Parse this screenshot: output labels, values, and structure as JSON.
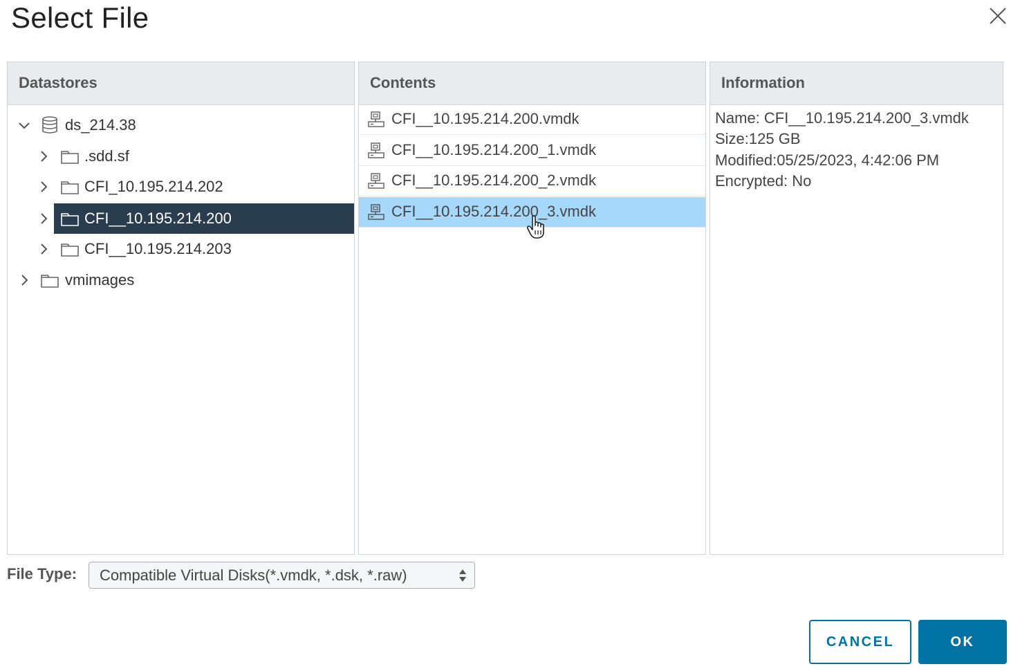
{
  "dialog": {
    "title": "Select File",
    "close_icon": "close-icon"
  },
  "datastores": {
    "header": "Datastores",
    "items": [
      {
        "label": "ds_214.38",
        "icon": "database-icon",
        "expanded": true,
        "level": 0
      },
      {
        "label": ".sdd.sf",
        "icon": "folder-icon",
        "expanded": false,
        "level": 1
      },
      {
        "label": "CFI_10.195.214.202",
        "icon": "folder-icon",
        "expanded": false,
        "level": 1
      },
      {
        "label": "CFI__10.195.214.200",
        "icon": "folder-icon",
        "expanded": false,
        "level": 1,
        "selected": true
      },
      {
        "label": "CFI__10.195.214.203",
        "icon": "folder-icon",
        "expanded": false,
        "level": 1
      },
      {
        "label": "vmimages",
        "icon": "folder-icon",
        "expanded": false,
        "level": 0
      }
    ]
  },
  "contents": {
    "header": "Contents",
    "items": [
      {
        "label": "CFI__10.195.214.200.vmdk",
        "icon": "virtual-disk-icon"
      },
      {
        "label": "CFI__10.195.214.200_1.vmdk",
        "icon": "virtual-disk-icon"
      },
      {
        "label": "CFI__10.195.214.200_2.vmdk",
        "icon": "virtual-disk-icon"
      },
      {
        "label": "CFI__10.195.214.200_3.vmdk",
        "icon": "virtual-disk-icon",
        "selected": true
      }
    ]
  },
  "information": {
    "header": "Information",
    "lines": [
      "Name: CFI__10.195.214.200_3.vmdk",
      "Size:125 GB",
      "Modified:05/25/2023, 4:42:06 PM",
      "Encrypted: No"
    ]
  },
  "file_type": {
    "label": "File Type:",
    "selected": "Compatible Virtual Disks(*.vmdk, *.dsk, *.raw)"
  },
  "buttons": {
    "cancel": "CANCEL",
    "ok": "OK"
  },
  "colors": {
    "tree_selected_bg": "#2a3d4f",
    "file_selected_bg": "#a6d8fb",
    "primary": "#0072a3",
    "header_bg": "#e9ecef"
  }
}
